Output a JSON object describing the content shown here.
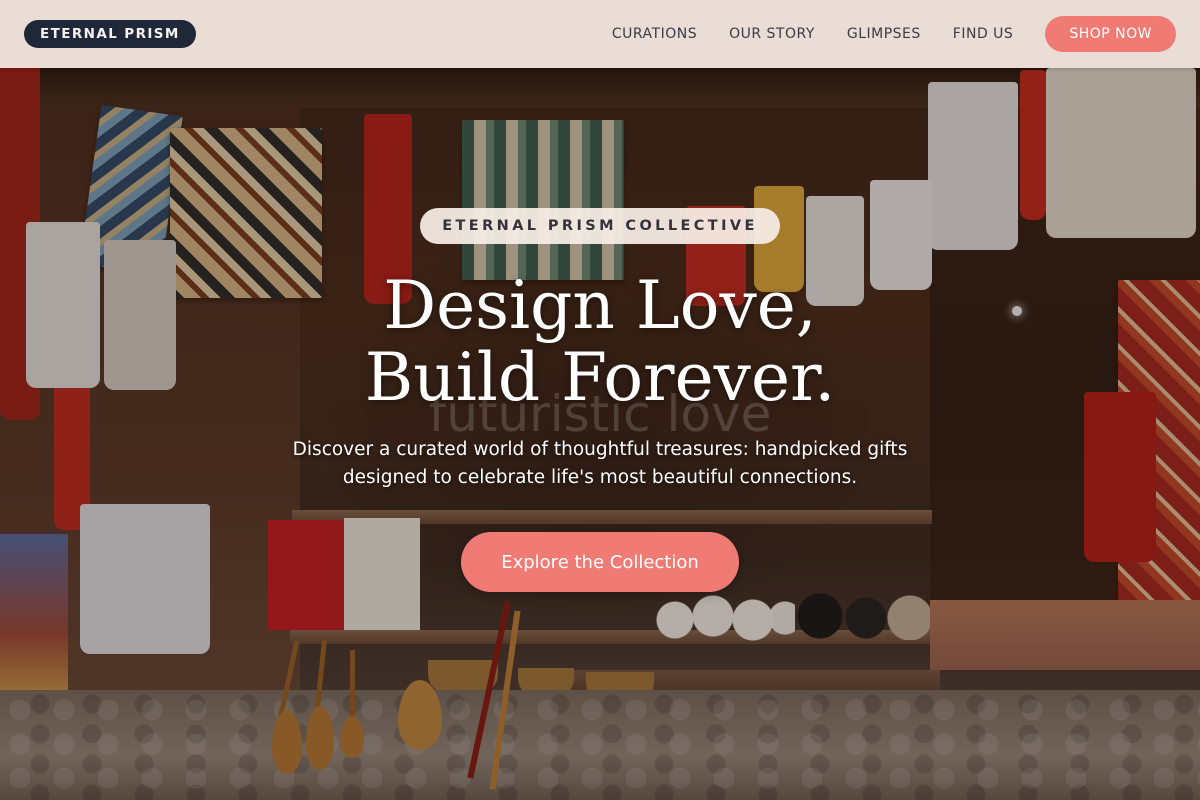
{
  "nav": {
    "brand": "ETERNAL PRISM",
    "links": [
      "CURATIONS",
      "OUR STORY",
      "GLIMPSES",
      "FIND US"
    ],
    "shop_label": "SHOP NOW"
  },
  "hero": {
    "pill_label": "ETERNAL PRISM COLLECTIVE",
    "headline_line1": "Design Love,",
    "headline_line2": "Build Forever.",
    "ghost_text": "futuristic love",
    "subtext": "Discover a curated world of thoughtful treasures: handpicked gifts designed to celebrate life's most beautiful connections.",
    "cta_label": "Explore the Collection",
    "background_image": "market-stall-with-rugs-and-crafts"
  },
  "colors": {
    "accent": "#ef7b74",
    "brand_pill": "#1f2838",
    "nav_bg": "#f4eae2",
    "nav_text": "#3b3b44"
  }
}
